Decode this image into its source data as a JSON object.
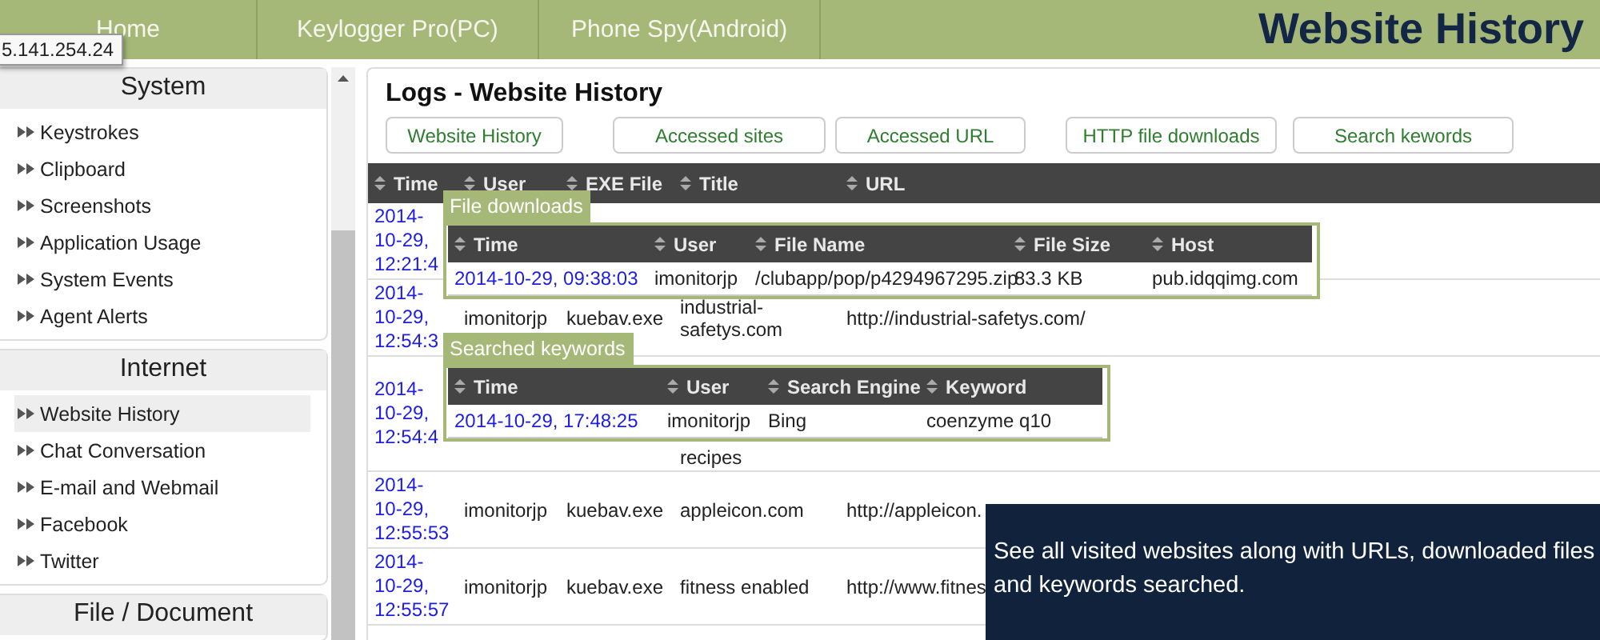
{
  "nav": {
    "tabs": [
      {
        "label": "Home",
        "selected": false
      },
      {
        "label": "Keylogger Pro(PC)",
        "selected": false
      },
      {
        "label": "Phone Spy(Android)",
        "selected": false
      }
    ],
    "page_title": "Website History",
    "tooltip": "5.141.254.24"
  },
  "sidebar": {
    "sections": [
      {
        "title": "System",
        "items": [
          {
            "label": "Keystrokes",
            "selected": false
          },
          {
            "label": "Clipboard",
            "selected": false
          },
          {
            "label": "Screenshots",
            "selected": false
          },
          {
            "label": "Application Usage",
            "selected": false
          },
          {
            "label": "System Events",
            "selected": false
          },
          {
            "label": "Agent Alerts",
            "selected": false
          }
        ]
      },
      {
        "title": "Internet",
        "items": [
          {
            "label": "Website History",
            "selected": true
          },
          {
            "label": "Chat Conversation",
            "selected": false
          },
          {
            "label": "E-mail and Webmail",
            "selected": false
          },
          {
            "label": "Facebook",
            "selected": false
          },
          {
            "label": "Twitter",
            "selected": false
          }
        ]
      },
      {
        "title": "File / Document"
      }
    ]
  },
  "logs": {
    "title": "Logs - Website History",
    "buttons": [
      "Website History",
      "Accessed sites",
      "Accessed URL",
      "HTTP file downloads",
      "Search kewords"
    ],
    "columns": [
      "Time",
      "User",
      "EXE File",
      "Title",
      "URL"
    ],
    "rows": [
      {
        "time": "2014-\n10-29,\n12:21:4"
      },
      {
        "time": "2014-\n10-29,\n12:54:3",
        "user": "imonitorjp",
        "exe": "kuebav.exe",
        "title": "industrial-safetys.com",
        "url": "http://industrial-safetys.com/"
      },
      {
        "time": "2014-\n10-29,\n12:54:4",
        "title": "recipes"
      },
      {
        "time": "2014-\n10-29,\n12:55:53",
        "user": "imonitorjp",
        "exe": "kuebav.exe",
        "title": "appleicon.com",
        "url": "http://appleicon."
      },
      {
        "time": "2014-\n10-29,\n12:55:57",
        "user": "imonitorjp",
        "exe": "kuebav.exe",
        "title": "fitness enabled",
        "url": "http://www.fitnes"
      }
    ]
  },
  "file_downloads": {
    "label": "File downloads",
    "columns": [
      "Time",
      "User",
      "File Name",
      "File Size",
      "Host"
    ],
    "rows": [
      [
        "2014-10-29, 09:38:03",
        "imonitorjp",
        "/clubapp/pop/p4294967295.zip",
        "83.3 KB",
        "pub.idqqimg.com"
      ]
    ]
  },
  "searched_keywords": {
    "label": "Searched keywords",
    "columns": [
      "Time",
      "User",
      "Search Engine",
      "Keyword"
    ],
    "rows": [
      [
        "2014-10-29, 17:48:25",
        "imonitorjp",
        "Bing",
        "coenzyme q10"
      ]
    ]
  },
  "caption": "See all visited websites along with URLs, downloaded files and keywords searched."
}
